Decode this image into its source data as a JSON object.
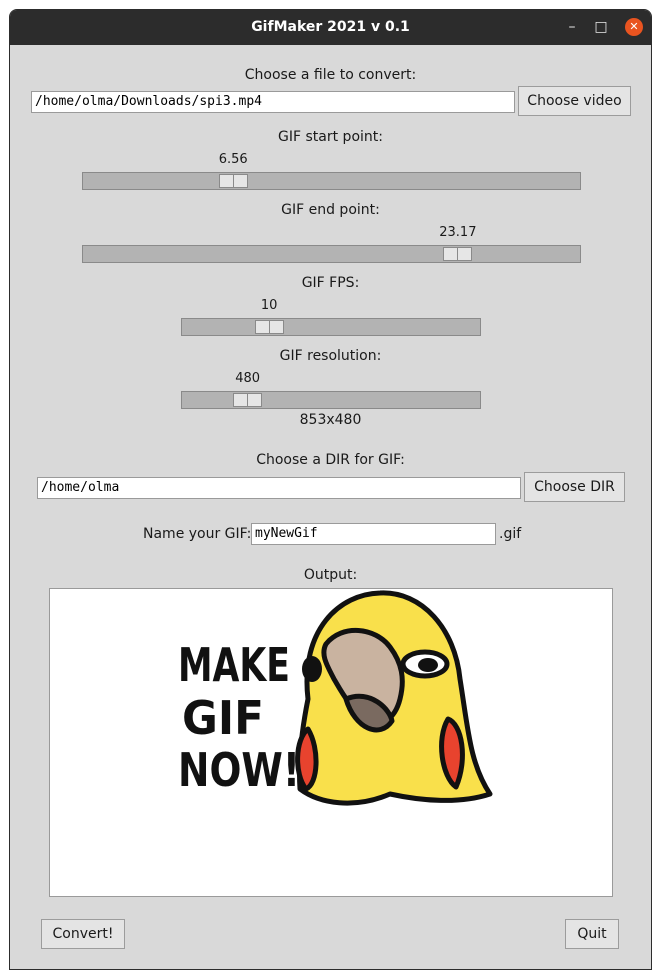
{
  "window": {
    "title": "GifMaker 2021 v 0.1",
    "minimize_glyph": "–",
    "maximize_glyph": "□",
    "close_glyph": "✕"
  },
  "file": {
    "label": "Choose a file to convert:",
    "path": "/home/olma/Downloads/spi3.mp4",
    "button": "Choose video"
  },
  "start": {
    "label": "GIF start point:",
    "value": "6.56",
    "fraction": 0.29
  },
  "end": {
    "label": "GIF end point:",
    "value": "23.17",
    "fraction": 0.77
  },
  "fps": {
    "label": "GIF FPS:",
    "value": "10",
    "fraction": 0.27
  },
  "resolution": {
    "label": "GIF resolution:",
    "value": "480",
    "fraction": 0.19,
    "display": "853x480"
  },
  "dir": {
    "label": "Choose a DIR for GIF:",
    "path": "/home/olma",
    "button": "Choose DIR"
  },
  "name": {
    "label": "Name your GIF:",
    "value": "myNewGif",
    "suffix": ".gif"
  },
  "output": {
    "label": "Output:",
    "image_text": [
      "MAKE",
      "GIF",
      "NOW!"
    ]
  },
  "buttons": {
    "convert": "Convert!",
    "quit": "Quit"
  },
  "colors": {
    "titlebar": "#2c2c2c",
    "background": "#d9d9d9",
    "close": "#e95420",
    "parrot": "#f9e04b",
    "cheek": "#e8432e"
  }
}
